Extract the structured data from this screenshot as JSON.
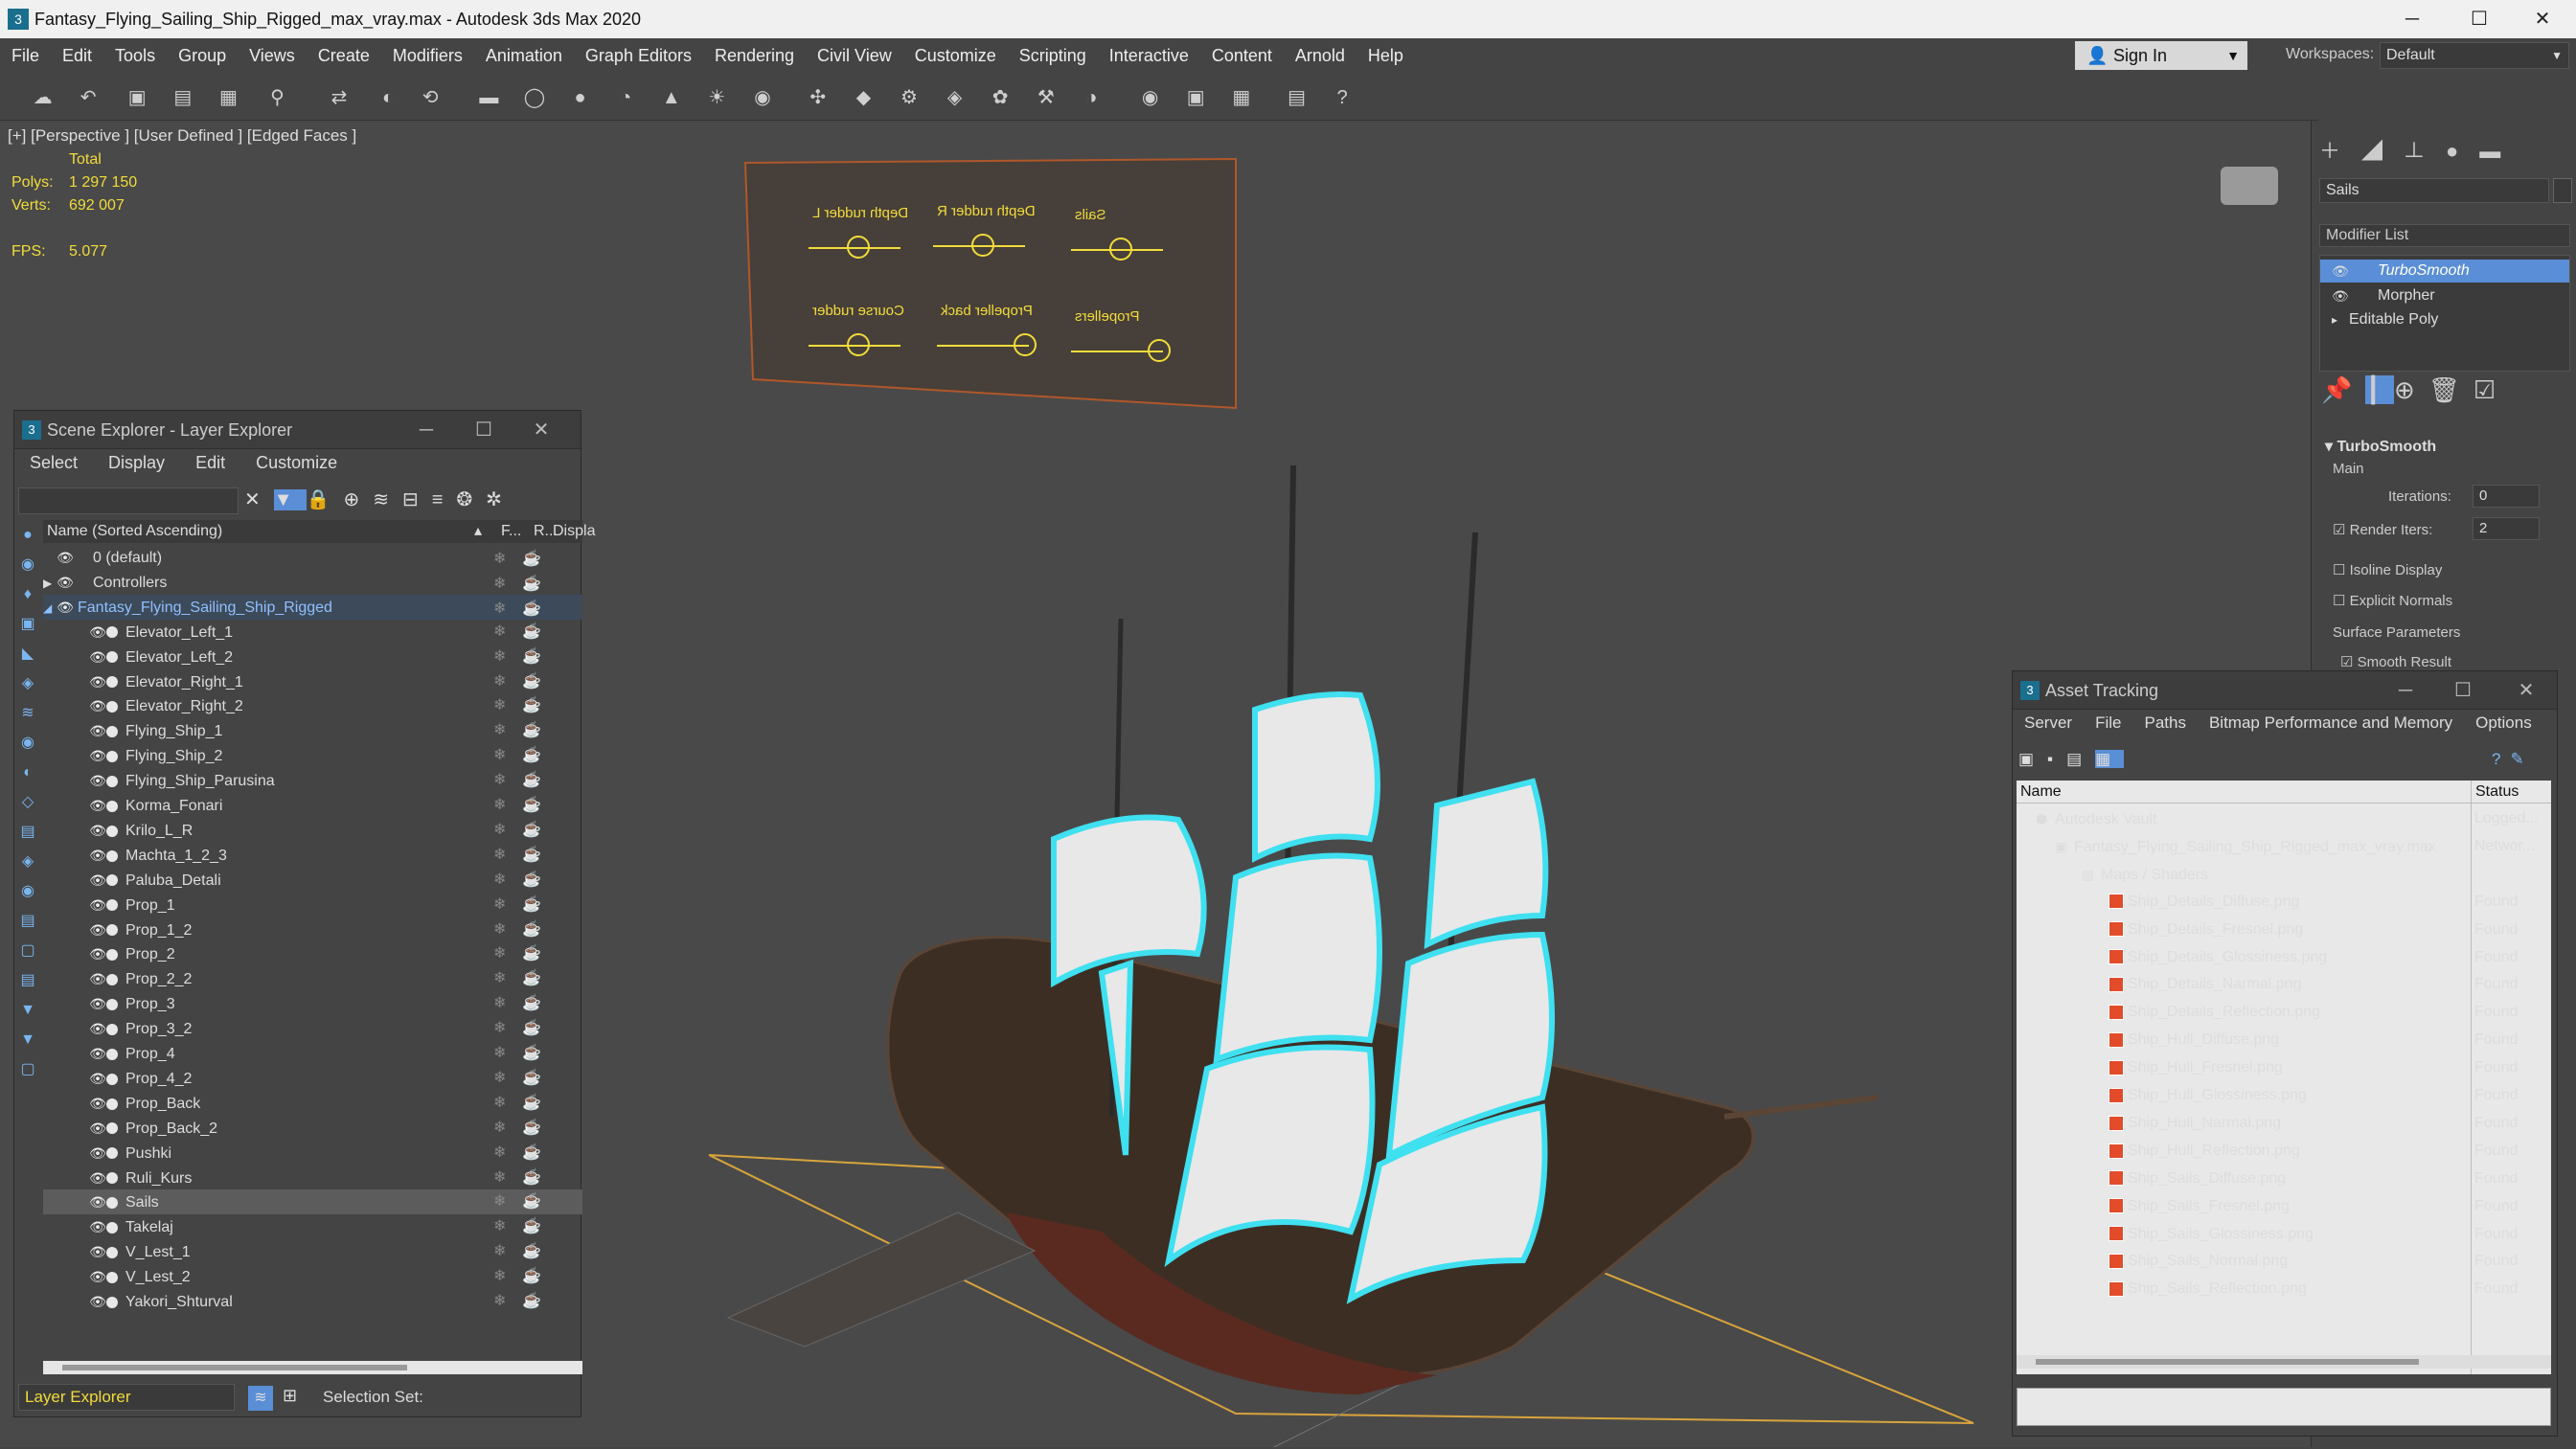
{
  "window": {
    "title": "Fantasy_Flying_Sailing_Ship_Rigged_max_vray.max - Autodesk 3ds Max 2020"
  },
  "menu": [
    "File",
    "Edit",
    "Tools",
    "Group",
    "Views",
    "Create",
    "Modifiers",
    "Animation",
    "Graph Editors",
    "Rendering",
    "Civil View",
    "Customize",
    "Scripting",
    "Interactive",
    "Content",
    "Arnold",
    "Help"
  ],
  "signin": {
    "label": "Sign In"
  },
  "workspace": {
    "label": "Workspaces:",
    "value": "Default"
  },
  "viewport": {
    "label": "[+] [Perspective ] [User Defined ] [Edged Faces ]",
    "total_label": "Total",
    "polys_label": "Polys:",
    "polys_value": "1 297 150",
    "verts_label": "Verts:",
    "verts_value": "692 007",
    "fps_label": "FPS:",
    "fps_value": "5.077",
    "controls": [
      "Depth rudder L",
      "Depth rudder R",
      "Sails",
      "Course rudder",
      "Propeller back",
      "Propellers"
    ]
  },
  "cmd": {
    "object_name": "Sails",
    "modifier_list": "Modifier List",
    "stack": [
      "TurboSmooth",
      "Morpher",
      "Editable Poly"
    ],
    "rollout": "TurboSmooth",
    "main": "Main",
    "iterations_label": "Iterations:",
    "iterations_value": "0",
    "render_iters_label": "Render Iters:",
    "render_iters_value": "2",
    "isoline": "Isoline Display",
    "explicit": "Explicit Normals",
    "surface": "Surface Parameters",
    "smooth": "Smooth Result"
  },
  "scene_explorer": {
    "title": "Scene Explorer - Layer Explorer",
    "menu": [
      "Select",
      "Display",
      "Edit",
      "Customize"
    ],
    "col_name": "Name (Sorted Ascending)",
    "col_f": "F...",
    "col_r": "R...",
    "col_disp": "Displa",
    "top_rows": [
      "0 (default)",
      "Controllers",
      "Fantasy_Flying_Sailing_Ship_Rigged"
    ],
    "items": [
      "Elevator_Left_1",
      "Elevator_Left_2",
      "Elevator_Right_1",
      "Elevator_Right_2",
      "Flying_Ship_1",
      "Flying_Ship_2",
      "Flying_Ship_Parusina",
      "Korma_Fonari",
      "Krilo_L_R",
      "Machta_1_2_3",
      "Paluba_Detali",
      "Prop_1",
      "Prop_1_2",
      "Prop_2",
      "Prop_2_2",
      "Prop_3",
      "Prop_3_2",
      "Prop_4",
      "Prop_4_2",
      "Prop_Back",
      "Prop_Back_2",
      "Pushki",
      "Ruli_Kurs",
      "Sails",
      "Takelaj",
      "V_Lest_1",
      "V_Lest_2",
      "Yakori_Shturval"
    ],
    "footer_layer": "Layer Explorer",
    "footer_selection": "Selection Set:"
  },
  "asset_tracking": {
    "title": "Asset Tracking",
    "menu": [
      "Server",
      "File",
      "Paths",
      "Bitmap Performance and Memory",
      "Options"
    ],
    "col_name": "Name",
    "col_status": "Status",
    "vault": {
      "name": "Autodesk Vault",
      "status": "Logged..."
    },
    "file": {
      "name": "Fantasy_Flying_Sailing_Ship_Rigged_max_vray.max",
      "status": "Networ..."
    },
    "maps": "Maps / Shaders",
    "textures": [
      {
        "name": "Ship_Details_Diffuse.png",
        "status": "Found"
      },
      {
        "name": "Ship_Details_Fresnel.png",
        "status": "Found"
      },
      {
        "name": "Ship_Details_Glossiness.png",
        "status": "Found"
      },
      {
        "name": "Ship_Details_Narmal.png",
        "status": "Found"
      },
      {
        "name": "Ship_Details_Reflection.png",
        "status": "Found"
      },
      {
        "name": "Ship_Hull_Diffuse.png",
        "status": "Found"
      },
      {
        "name": "Ship_Hull_Fresnel.png",
        "status": "Found"
      },
      {
        "name": "Ship_Hull_Glossiness.png",
        "status": "Found"
      },
      {
        "name": "Ship_Hull_Narmal.png",
        "status": "Found"
      },
      {
        "name": "Ship_Hull_Reflection.png",
        "status": "Found"
      },
      {
        "name": "Ship_Sails_Diffuse.png",
        "status": "Found"
      },
      {
        "name": "Ship_Sails_Fresnel.png",
        "status": "Found"
      },
      {
        "name": "Ship_Sails_Glossiness.png",
        "status": "Found"
      },
      {
        "name": "Ship_Sails_Normal.png",
        "status": "Found"
      },
      {
        "name": "Ship_Sails_Reflection.png",
        "status": "Found"
      }
    ]
  },
  "colors": {
    "accent": "#5aa0e6",
    "stat_yellow": "#f2dc3a",
    "selection_cyan": "#3fe0f0",
    "grid_orange": "#d9a43c"
  }
}
